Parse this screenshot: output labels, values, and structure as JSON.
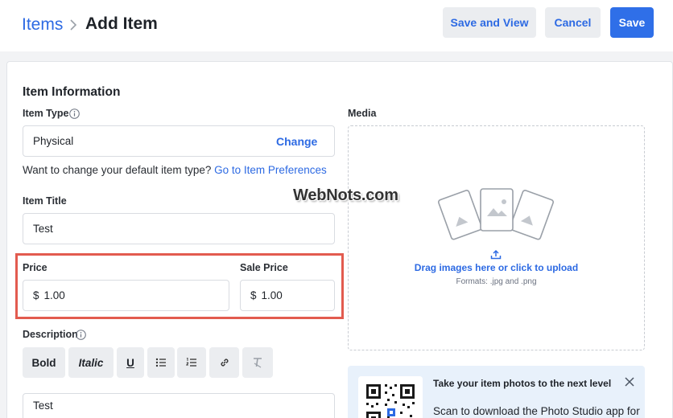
{
  "breadcrumb": {
    "parent": "Items",
    "current": "Add Item"
  },
  "header_actions": {
    "save_and_view": "Save and View",
    "cancel": "Cancel",
    "save": "Save"
  },
  "item_information": {
    "title": "Item Information",
    "item_type": {
      "label": "Item Type",
      "value": "Physical",
      "change": "Change"
    },
    "hint": {
      "text": "Want to change your default item type?",
      "link": "Go to Item Preferences"
    },
    "item_title": {
      "label": "Item Title",
      "value": "Test"
    },
    "price": {
      "label": "Price",
      "currency": "$",
      "value": "1.00"
    },
    "sale_price": {
      "label": "Sale Price",
      "currency": "$",
      "value": "1.00"
    },
    "description": {
      "label": "Description",
      "toolbar": {
        "bold": "Bold",
        "italic": "Italic",
        "underline": "U"
      },
      "value": "Test"
    }
  },
  "media": {
    "label": "Media",
    "upload_text": "Drag images here or click to upload",
    "formats": "Formats: .jpg and .png"
  },
  "watermark": "WebNots.com",
  "promo": {
    "title": "Take your item photos to the next level",
    "text": "Scan to download the Photo Studio app for"
  },
  "colors": {
    "accent": "#2d6ae3",
    "primary_button": "#2f6fe8",
    "highlight": "#e25b4f",
    "promo_bg": "#e8f1fb"
  },
  "icons": [
    "chevron-right-icon",
    "info-icon",
    "bullet-list-icon",
    "numbered-list-icon",
    "link-icon",
    "clear-format-icon",
    "image-placeholder-icon",
    "upload-icon",
    "qr-code",
    "close-icon"
  ]
}
